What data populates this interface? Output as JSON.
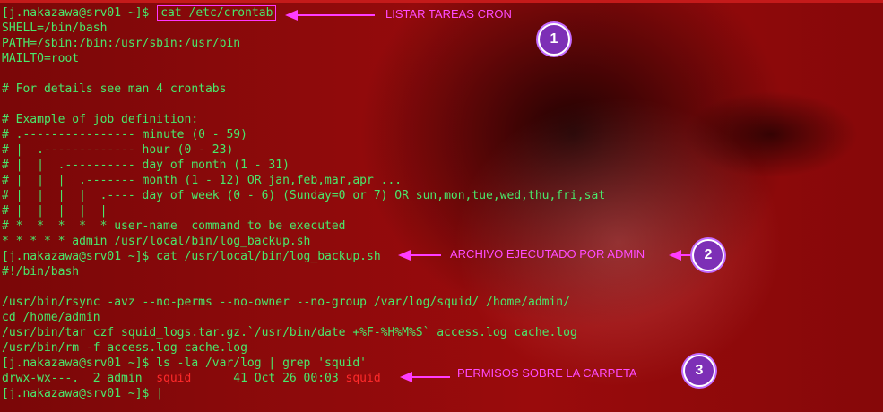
{
  "terminal": {
    "lines": [
      {
        "prompt": "[j.nakazawa@srv01 ~]$",
        "command": "cat /etc/crontab"
      },
      {
        "text": "SHELL=/bin/bash"
      },
      {
        "text": "PATH=/sbin:/bin:/usr/sbin:/usr/bin"
      },
      {
        "text": "MAILTO=root"
      },
      {
        "text": ""
      },
      {
        "text": "# For details see man 4 crontabs"
      },
      {
        "text": ""
      },
      {
        "text": "# Example of job definition:"
      },
      {
        "text": "# .---------------- minute (0 - 59)"
      },
      {
        "text": "# |  .------------- hour (0 - 23)"
      },
      {
        "text": "# |  |  .---------- day of month (1 - 31)"
      },
      {
        "text": "# |  |  |  .------- month (1 - 12) OR jan,feb,mar,apr ..."
      },
      {
        "text": "# |  |  |  |  .---- day of week (0 - 6) (Sunday=0 or 7) OR sun,mon,tue,wed,thu,fri,sat"
      },
      {
        "text": "# |  |  |  |  |"
      },
      {
        "text": "# *  *  *  *  * user-name  command to be executed"
      },
      {
        "text": "* * * * * admin /usr/local/bin/log_backup.sh"
      },
      {
        "text": "[j.nakazawa@srv01 ~]$ cat /usr/local/bin/log_backup.sh"
      },
      {
        "text": "#!/bin/bash"
      },
      {
        "text": ""
      },
      {
        "text": "/usr/bin/rsync -avz --no-perms --no-owner --no-group /var/log/squid/ /home/admin/"
      },
      {
        "text": "cd /home/admin"
      },
      {
        "text": "/usr/bin/tar czf squid_logs.tar.gz.`/usr/bin/date +%F-%H%M%S` access.log cache.log"
      },
      {
        "text": "/usr/bin/rm -f access.log cache.log"
      },
      {
        "text": "[j.nakazawa@srv01 ~]$ ls -la /var/log | grep 'squid'"
      },
      {
        "perm": "drwx-wx---.  2 admin  ",
        "group": "squid",
        "mid": "      41 Oct 26 00:03 ",
        "name": "squid"
      },
      {
        "prompt": "[j.nakazawa@srv01 ~]$",
        "cursor": "|"
      }
    ]
  },
  "annotations": [
    {
      "label": "LISTAR TAREAS CRON",
      "number": "1"
    },
    {
      "label": "ARCHIVO EJECUTADO POR ADMIN",
      "number": "2"
    },
    {
      "label": "PERMISOS SOBRE LA CARPETA",
      "number": "3"
    }
  ],
  "colors": {
    "terminal_text": "#49e86b",
    "highlight_red": "#ff2a2a",
    "annotation": "#ff4bff",
    "badge_fill": "#7d2fb6",
    "background": "#8e0a0b"
  }
}
